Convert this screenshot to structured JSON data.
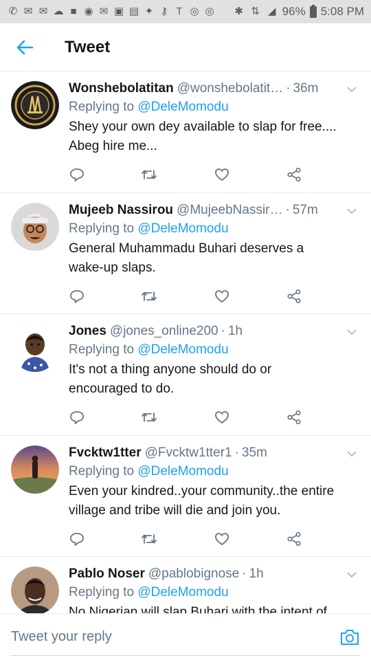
{
  "status_bar": {
    "left_icons": [
      "phone-icon",
      "mail-icon",
      "mail-icon",
      "cloud-icon",
      "chat-icon",
      "messenger-icon",
      "mail-icon",
      "flipboard-icon",
      "news-icon",
      "twitter-icon",
      "key-icon",
      "t-icon",
      "instagram-icon",
      "instagram-icon"
    ],
    "battery": "96%",
    "time": "5:08 PM"
  },
  "header": {
    "title": "Tweet"
  },
  "tweets": [
    {
      "name": "Wonshebolatitan",
      "handle": "@wonshebolatit…",
      "time": "36m",
      "reply_prefix": "Replying to",
      "reply_to": "@DeleMomodu",
      "text_lines": [
        "Shey your own dey available to slap for free....",
        "Abeg hire me..."
      ]
    },
    {
      "name": "Mujeeb Nassirou",
      "handle": "@MujeebNassir…",
      "time": "57m",
      "reply_prefix": "Replying to",
      "reply_to": "@DeleMomodu",
      "text_lines": [
        "General Muhammadu Buhari deserves a",
        "wake-up slaps."
      ]
    },
    {
      "name": "Jones",
      "handle": "@jones_online200",
      "time": "1h",
      "reply_prefix": "Replying to",
      "reply_to": "@DeleMomodu",
      "text_lines": [
        "It's not a thing anyone should do or",
        "encouraged to do."
      ]
    },
    {
      "name": "Fvcktw1tter",
      "handle": "@Fvcktw1tter1",
      "time": "35m",
      "reply_prefix": "Replying to",
      "reply_to": "@DeleMomodu",
      "text_lines": [
        "Even your kindred..your community..the entire",
        "village and tribe will die and join you."
      ]
    },
    {
      "name": "Pablo Noser",
      "handle": "@pablobignose",
      "time": "1h",
      "reply_prefix": "Replying to",
      "reply_to": "@DeleMomodu",
      "text_lines": [
        "No Nigerian will slap Buhari with the intent of"
      ]
    }
  ],
  "compose": {
    "placeholder": "Tweet your reply"
  },
  "colors": {
    "accent": "#1da1f2",
    "muted": "#657786",
    "text": "#14171a",
    "divider": "#e6ecf0",
    "status_bg": "#e1e1e1"
  }
}
